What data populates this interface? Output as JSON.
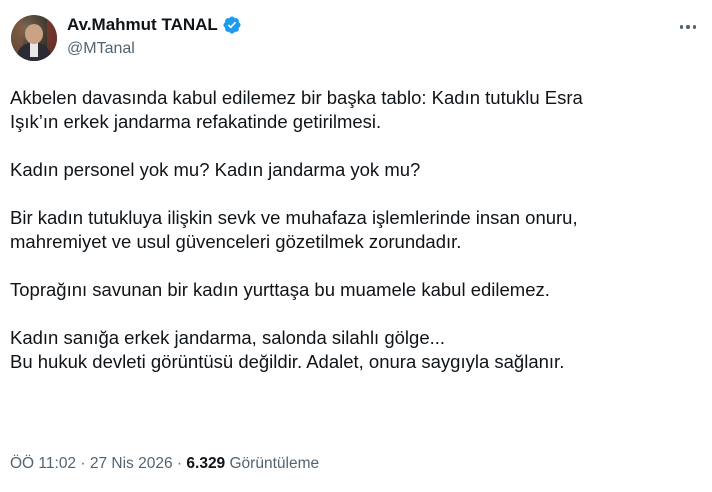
{
  "author": {
    "display_name": "Av.Mahmut TANAL",
    "handle": "@MTanal",
    "verified": true,
    "verified_color": "#1d9bf0"
  },
  "tweet": {
    "paragraphs": [
      [
        "Akbelen davasında kabul edilemez bir başka tablo: Kadın tutuklu Esra",
        "Işık’ın erkek jandarma refakatinde getirilmesi."
      ],
      [
        "Kadın personel yok mu? Kadın jandarma yok mu?"
      ],
      [
        "Bir kadın tutukluya ilişkin sevk ve muhafaza işlemlerinde insan onuru,",
        "mahremiyet ve usul güvenceleri gözetilmek zorundadır."
      ],
      [
        "Toprağını savunan bir kadın yurttaşa bu muamele kabul edilemez."
      ],
      [
        "Kadın sanığa erkek jandarma, salonda silahlı gölge...",
        "Bu hukuk devleti görüntüsü değildir. Adalet, onura saygıyla sağlanır."
      ]
    ]
  },
  "meta": {
    "time": "ÖÖ 11:02",
    "separator": "·",
    "date": "27 Nis 2026",
    "views_count": "6.329",
    "views_label": "Görüntüleme"
  },
  "icons": {
    "more": "more-horizontal-icon",
    "verified": "verified-badge-icon"
  }
}
